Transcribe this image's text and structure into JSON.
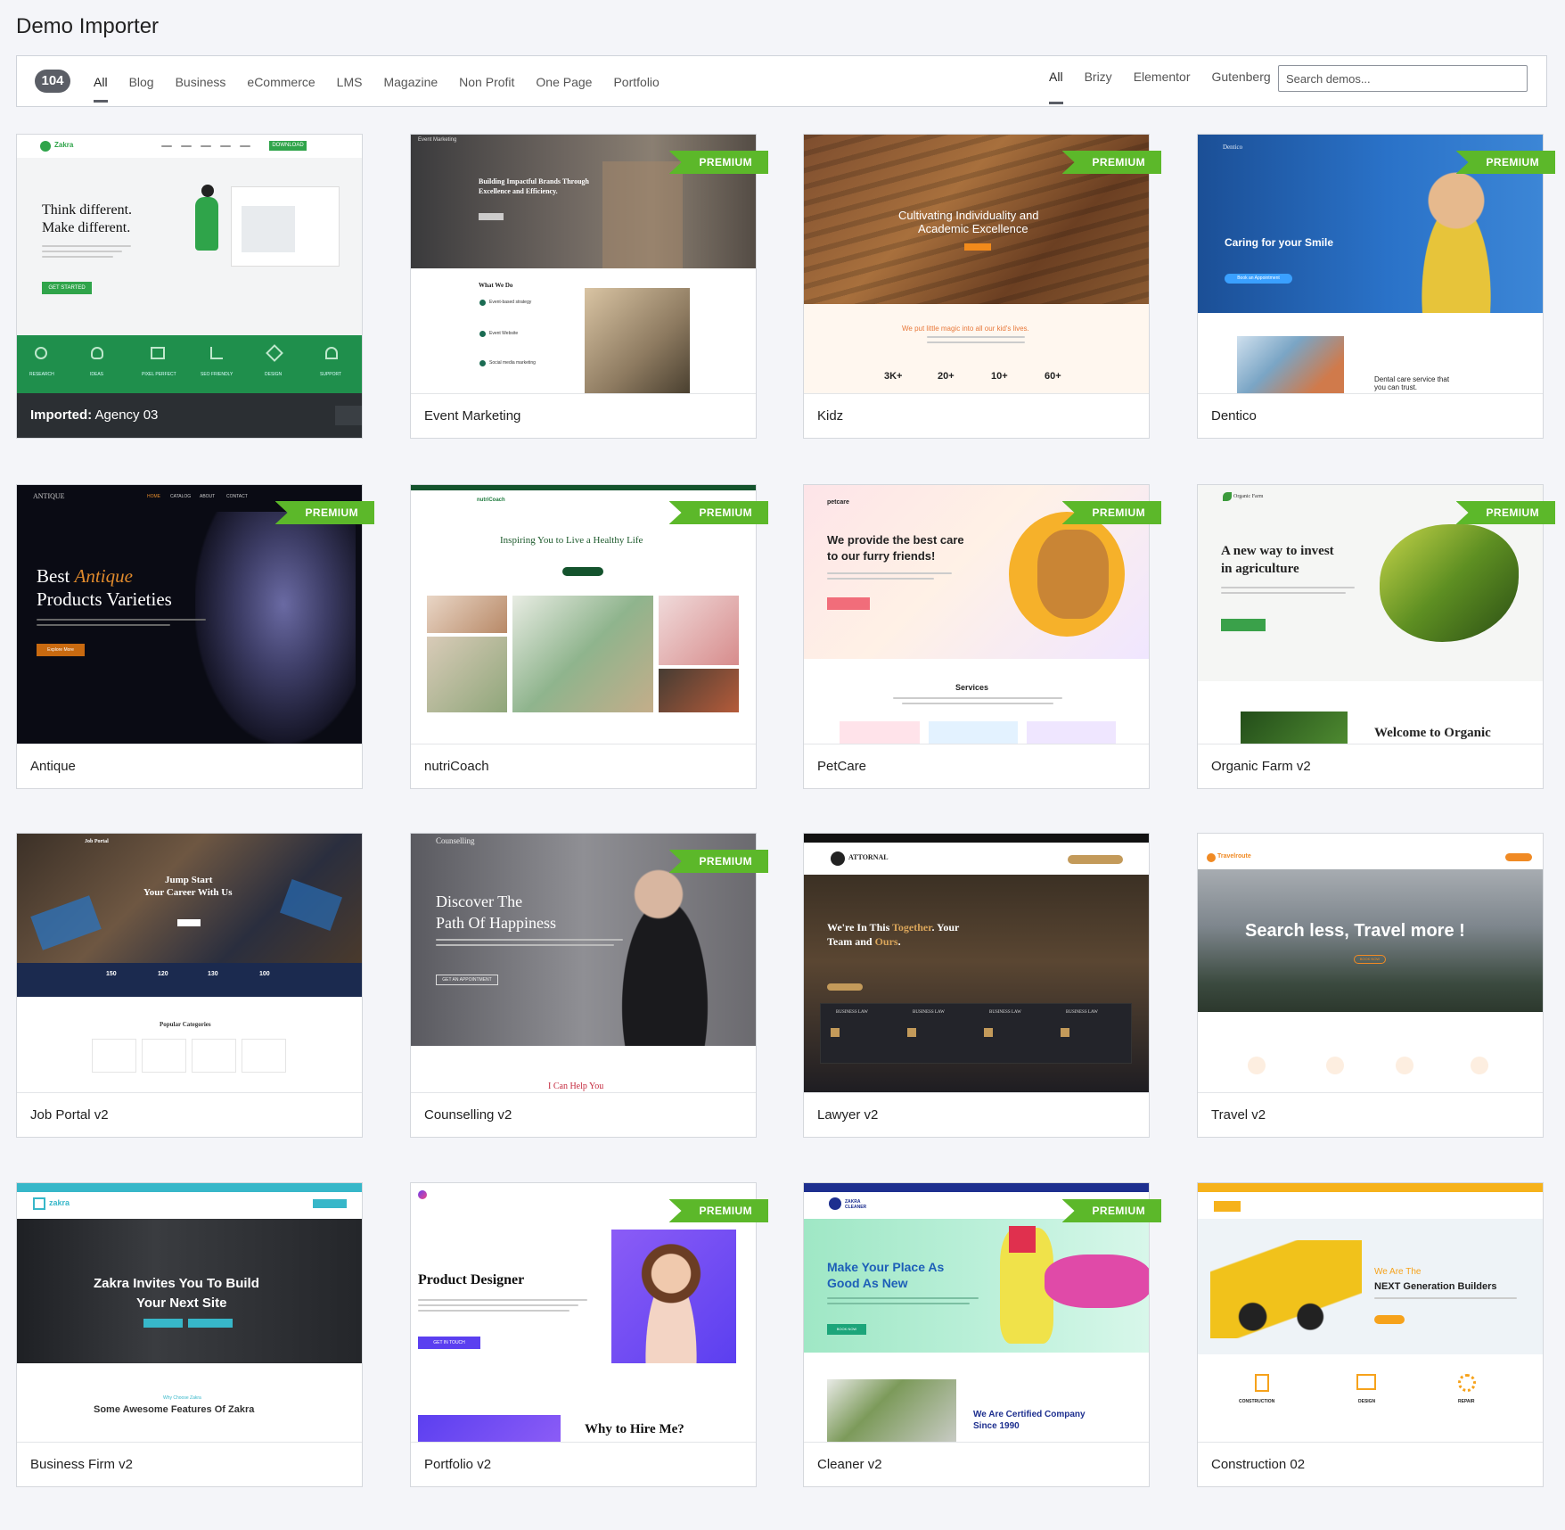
{
  "page_title": "Demo Importer",
  "demo_count": "104",
  "categories": [
    {
      "label": "All",
      "active": true
    },
    {
      "label": "Blog"
    },
    {
      "label": "Business"
    },
    {
      "label": "eCommerce"
    },
    {
      "label": "LMS"
    },
    {
      "label": "Magazine"
    },
    {
      "label": "Non Profit"
    },
    {
      "label": "One Page"
    },
    {
      "label": "Portfolio"
    }
  ],
  "builders": [
    {
      "label": "All",
      "active": true
    },
    {
      "label": "Brizy"
    },
    {
      "label": "Elementor"
    },
    {
      "label": "Gutenberg"
    }
  ],
  "search": {
    "placeholder": "Search demos..."
  },
  "premium_label": "PREMIUM",
  "imported_prefix": "Imported:",
  "demos": [
    {
      "name": "Agency 03",
      "imported": true,
      "thumb": {
        "logo": "Zakra",
        "cta": "DOWNLOAD",
        "heading1": "Think different.",
        "heading2": "Make different.",
        "button": "GET STARTED",
        "features": [
          "RESEARCH",
          "IDEAS",
          "PIXEL PERFECT",
          "SEO FRIENDLY",
          "DESIGN",
          "SUPPORT"
        ]
      }
    },
    {
      "name": "Event Marketing",
      "premium": true,
      "thumb": {
        "tag": "Event Marketing",
        "heading1": "Building Impactful Brands Through",
        "heading2": "Excellence and Efficiency.",
        "section": "What We Do",
        "items": [
          "Event-based strategy",
          "Event Website",
          "Social media marketing"
        ]
      }
    },
    {
      "name": "Kidz",
      "premium": true,
      "thumb": {
        "heading1": "Cultivating Individuality and",
        "heading2": "Academic Excellence",
        "tagline": "We put little magic into all our kid's lives.",
        "stats": [
          "3K+",
          "20+",
          "10+",
          "60+"
        ]
      }
    },
    {
      "name": "Dentico",
      "premium": true,
      "thumb": {
        "logo": "Dentico",
        "heading": "Caring for your Smile",
        "button": "Book an Appointment",
        "sub1": "Dental care service that",
        "sub2": "you can trust."
      }
    },
    {
      "name": "Antique",
      "premium": true,
      "thumb": {
        "logo": "ANTIQUE",
        "nav": [
          "HOME",
          "CATALOG",
          "ABOUT",
          "CONTACT"
        ],
        "heading_a": "Best",
        "heading_b": "Antique",
        "heading_c": "Products Varieties",
        "button": "Explore More"
      }
    },
    {
      "name": "nutriCoach",
      "premium": true,
      "thumb": {
        "logo": "nutriCoach",
        "heading": "Inspiring You to Live a Healthy Life"
      }
    },
    {
      "name": "PetCare",
      "premium": true,
      "thumb": {
        "logo": "petcare",
        "heading1": "We provide the best care",
        "heading2": "to our furry friends!",
        "section": "Services"
      }
    },
    {
      "name": "Organic Farm v2",
      "premium": true,
      "thumb": {
        "logo": "Organic Farm",
        "heading1": "A new way to invest",
        "heading2": "in agriculture",
        "welcome": "Welcome to Organic"
      }
    },
    {
      "name": "Job Portal v2",
      "thumb": {
        "logo": "Job Portal",
        "heading1": "Jump Start",
        "heading2": "Your Career With Us",
        "stats": [
          "150",
          "120",
          "130",
          "100"
        ],
        "section": "Popular Categories"
      }
    },
    {
      "name": "Counselling v2",
      "premium": true,
      "thumb": {
        "logo": "Counselling",
        "heading1": "Discover The",
        "heading2": "Path Of Happiness",
        "button": "GET AN APPOINTMENT",
        "footer": "I Can Help You"
      }
    },
    {
      "name": "Lawyer v2",
      "thumb": {
        "logo": "ATTORNAL",
        "heading1a": "We're In This ",
        "heading1b": "Together",
        "heading1c": ". Your",
        "heading2a": "Team and ",
        "heading2b": "Ours",
        "heading2c": ".",
        "services": [
          "BUSINESS LAW",
          "BUSINESS LAW",
          "BUSINESS LAW",
          "BUSINESS LAW"
        ]
      }
    },
    {
      "name": "Travel v2",
      "thumb": {
        "logo": "Travelroute",
        "heading": "Search less, Travel more !",
        "button": "BOOK NOW"
      }
    },
    {
      "name": "Business Firm v2",
      "thumb": {
        "logo": "zakra",
        "heading1": "Zakra Invites You To Build",
        "heading2": "Your Next Site",
        "sub": "Why Choose Zakra",
        "section": "Some Awesome Features Of Zakra"
      }
    },
    {
      "name": "Portfolio v2",
      "premium": true,
      "thumb": {
        "heading": "Product Designer",
        "button": "GET IN TOUCH",
        "section": "Why to Hire Me?"
      }
    },
    {
      "name": "Cleaner v2",
      "premium": true,
      "thumb": {
        "logo": "ZAKRA CLEANER",
        "heading1": "Make Your Place As",
        "heading2": "Good As New",
        "button": "BOOK NOW",
        "sub1": "We Are Certified Company",
        "sub2": "Since 1990"
      }
    },
    {
      "name": "Construction 02",
      "thumb": {
        "sub": "We Are The",
        "heading": "NEXT Generation Builders",
        "features": [
          "CONSTRUCTION",
          "DESIGN",
          "REPAIR"
        ]
      }
    }
  ],
  "colors": {
    "premium": "#5cb82a",
    "badge": "#5b5e66",
    "imported_footer": "#2b2f33"
  }
}
